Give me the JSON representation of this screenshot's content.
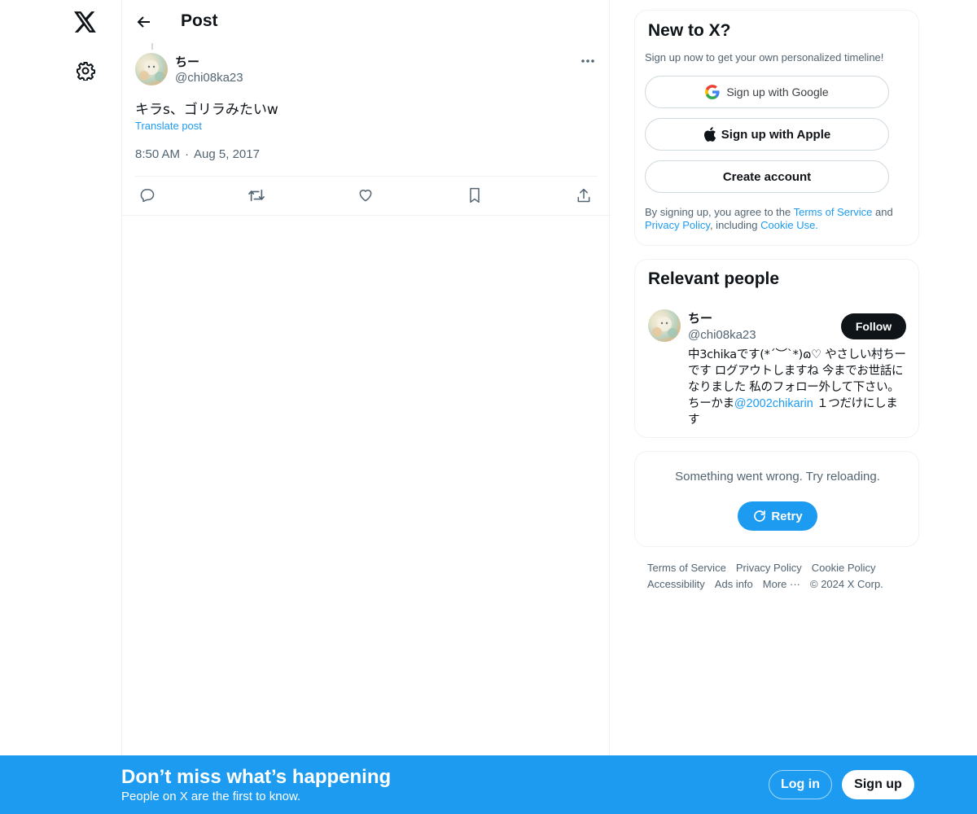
{
  "nav": {
    "logo_icon": "x-logo-icon",
    "settings_icon": "gear-icon"
  },
  "header": {
    "title": "Post",
    "back_icon": "arrow-left-icon"
  },
  "post": {
    "author_name": "ちー",
    "author_handle": "@chi08ka23",
    "text": "キラs、ゴリラみたいw",
    "translate_label": "Translate post",
    "time": "8:50 AM",
    "date": "Aug 5, 2017",
    "actions": [
      "reply-icon",
      "repost-icon",
      "like-icon",
      "bookmark-icon",
      "share-icon"
    ]
  },
  "signup_card": {
    "title": "New to X?",
    "subtitle": "Sign up now to get your own personalized timeline!",
    "google_label": "Sign up with Google",
    "apple_label": "Sign up with Apple",
    "create_label": "Create account",
    "legal_prefix": "By signing up, you agree to the ",
    "terms_label": "Terms of Service",
    "legal_and": " and",
    "privacy_label": "Privacy Policy",
    "legal_including": ", including ",
    "cookie_label": "Cookie Use."
  },
  "relevant_people": {
    "title": "Relevant people",
    "name": "ちー",
    "handle": "@chi08ka23",
    "follow_label": "Follow",
    "bio_before": "中3chikaです(*´︶`*)ɷ♡ やさしい村ちーです ログアウトしますね 今までお世話になりました 私のフォロー外して下さい。 ちーかま",
    "bio_mention": "@2002chikarin",
    "bio_after": " １つだけにします"
  },
  "error_card": {
    "message": "Something went wrong. Try reloading.",
    "retry_label": "Retry"
  },
  "footer": {
    "links": [
      "Terms of Service",
      "Privacy Policy",
      "Cookie Policy",
      "Accessibility",
      "Ads info",
      "More ···"
    ],
    "copyright": "© 2024 X Corp."
  },
  "bottom_bar": {
    "title": "Don’t miss what’s happening",
    "subtitle": "People on X are the first to know.",
    "login_label": "Log in",
    "signup_label": "Sign up"
  },
  "colors": {
    "accent": "#1d9bf0",
    "text": "#0f1419",
    "muted": "#536471",
    "border": "#eff3f4"
  }
}
